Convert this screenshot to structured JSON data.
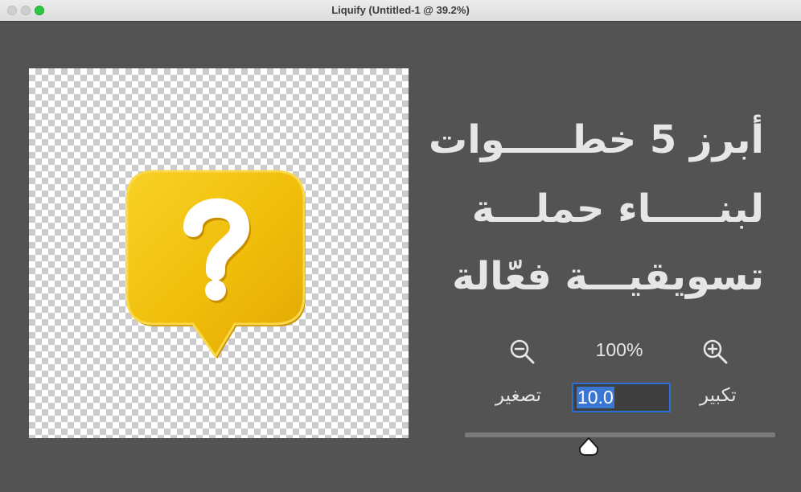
{
  "window": {
    "title": "Liquify (Untitled-1 @ 39.2%)",
    "controls": [
      "close",
      "minimize",
      "maximize"
    ]
  },
  "canvas": {
    "image": "yellow speech bubble with white question mark",
    "background": "transparency-checkerboard"
  },
  "headline": {
    "line1": "أبرز 5 خطـــــوات",
    "line2": "لبنـــــاء حملـــة",
    "line3": "تسويقيـــة فعّالة"
  },
  "zoom": {
    "percent": "100%",
    "zoom_out_icon": "zoom-out-icon",
    "zoom_in_icon": "zoom-in-icon",
    "zoom_out_label": "تصغير",
    "zoom_in_label": "تكبير",
    "value": "10.0"
  },
  "slider": {
    "level": 0.4
  },
  "colors": {
    "panel_bg": "#535353",
    "bubble_yellow": "#f2c10c",
    "input_border": "#2a6fd6",
    "selection": "#3a77d3"
  }
}
